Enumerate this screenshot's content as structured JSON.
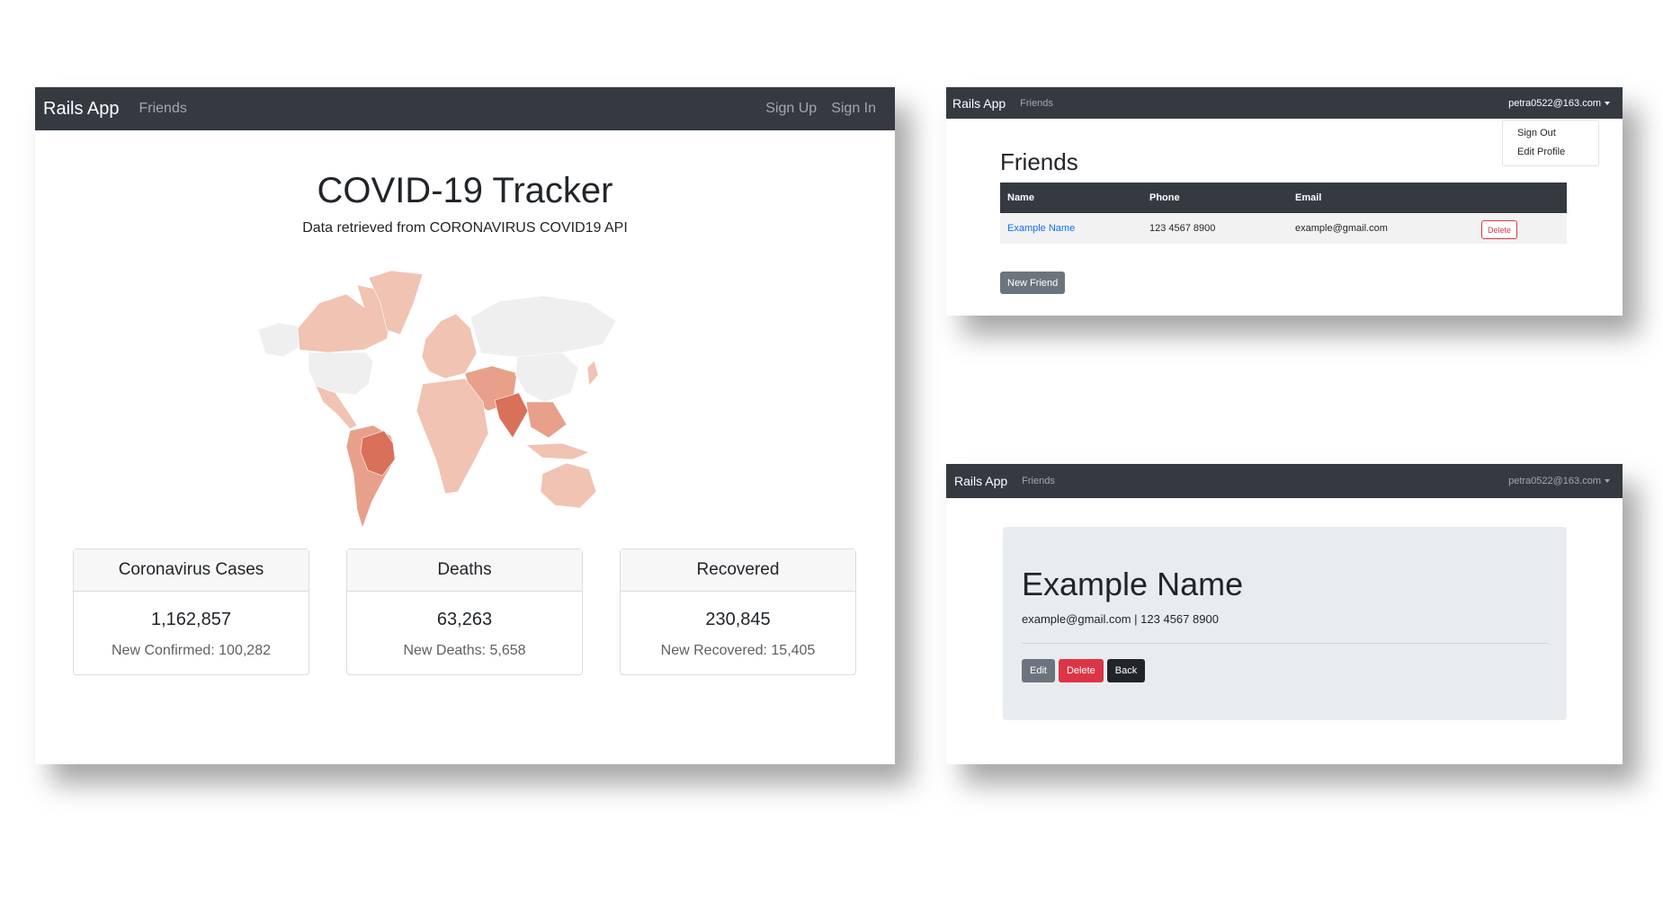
{
  "tracker": {
    "brand": "Rails App",
    "nav_friends": "Friends",
    "sign_up": "Sign Up",
    "sign_in": "Sign In",
    "title": "COVID-19 Tracker",
    "subtitle": "Data retrieved from CORONAVIRUS COVID19 API",
    "cards": [
      {
        "header": "Coronavirus Cases",
        "value": "1,162,857",
        "sub": "New Confirmed: 100,282"
      },
      {
        "header": "Deaths",
        "value": "63,263",
        "sub": "New Deaths: 5,658"
      },
      {
        "header": "Recovered",
        "value": "230,845",
        "sub": "New Recovered: 15,405"
      }
    ],
    "map_colors": {
      "light": "#f0c3b2",
      "mid": "#e8a08a",
      "dark": "#d9705a",
      "none": "#efefef"
    }
  },
  "friends_page": {
    "brand": "Rails App",
    "nav_friends": "Friends",
    "user_email": "petra0522@163.com",
    "dropdown": [
      "Sign Out",
      "Edit Profile"
    ],
    "title": "Friends",
    "columns": [
      "Name",
      "Phone",
      "Email"
    ],
    "rows": [
      {
        "name": "Example Name",
        "phone": "123 4567 8900",
        "email": "example@gmail.com",
        "action": "Delete"
      }
    ],
    "new_button": "New Friend"
  },
  "detail_page": {
    "brand": "Rails App",
    "nav_friends": "Friends",
    "user_email": "petra0522@163.com",
    "name": "Example Name",
    "info": "example@gmail.com | 123 4567 8900",
    "buttons": {
      "edit": "Edit",
      "delete": "Delete",
      "back": "Back"
    }
  }
}
